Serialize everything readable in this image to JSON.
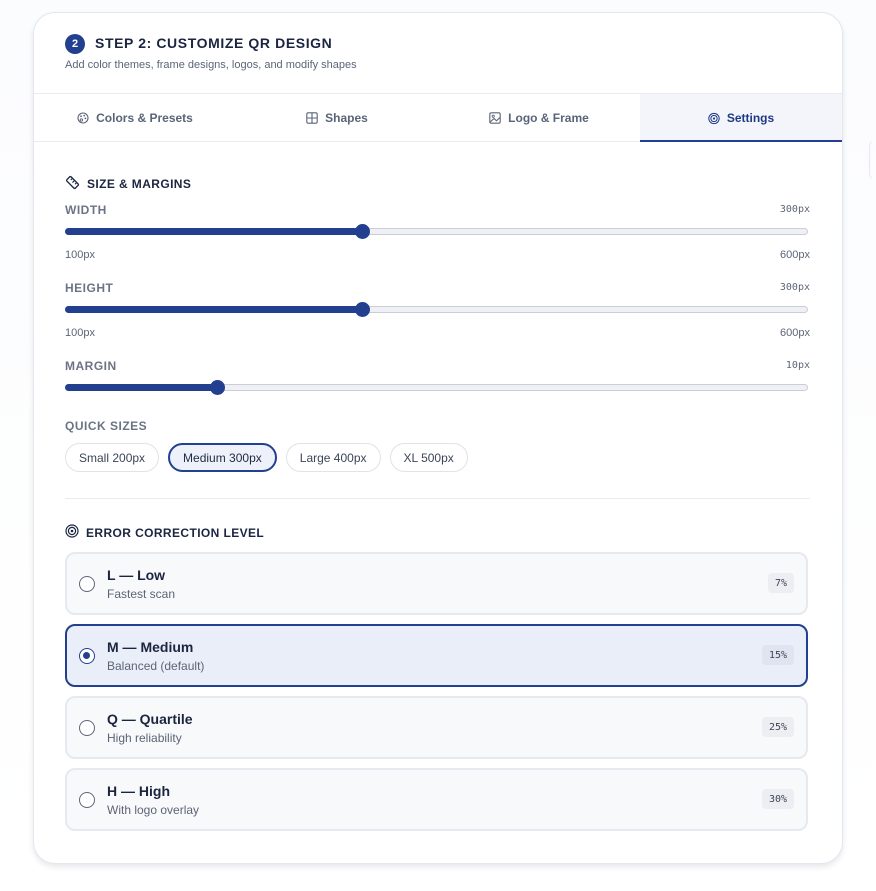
{
  "header": {
    "step_number": "2",
    "title": "STEP 2: CUSTOMIZE QR DESIGN",
    "subtitle": "Add color themes, frame designs, logos, and modify shapes"
  },
  "tabs": [
    {
      "label": "Colors & Presets",
      "icon": "palette-icon",
      "active": false
    },
    {
      "label": "Shapes",
      "icon": "grid-icon",
      "active": false
    },
    {
      "label": "Logo & Frame",
      "icon": "image-icon",
      "active": false
    },
    {
      "label": "Settings",
      "icon": "target-icon",
      "active": true
    }
  ],
  "size_margins": {
    "title": "SIZE & MARGINS",
    "icon": "ruler-icon",
    "width": {
      "label": "WIDTH",
      "value": "300px",
      "min": "100px",
      "max": "600px",
      "fraction": 0.4
    },
    "height": {
      "label": "HEIGHT",
      "value": "300px",
      "min": "100px",
      "max": "600px",
      "fraction": 0.4
    },
    "margin": {
      "label": "MARGIN",
      "value": "10px",
      "fraction": 0.205
    }
  },
  "quick_sizes": {
    "label": "QUICK SIZES",
    "options": [
      {
        "label": "Small 200px",
        "selected": false
      },
      {
        "label": "Medium 300px",
        "selected": true
      },
      {
        "label": "Large 400px",
        "selected": false
      },
      {
        "label": "XL 500px",
        "selected": false
      }
    ]
  },
  "error_correction": {
    "title": "ERROR CORRECTION LEVEL",
    "icon": "target-icon",
    "options": [
      {
        "title": "L — Low",
        "subtitle": "Fastest scan",
        "badge": "7%",
        "selected": false
      },
      {
        "title": "M — Medium",
        "subtitle": "Balanced (default)",
        "badge": "15%",
        "selected": true
      },
      {
        "title": "Q — Quartile",
        "subtitle": "High reliability",
        "badge": "25%",
        "selected": false
      },
      {
        "title": "H — High",
        "subtitle": "With logo overlay",
        "badge": "30%",
        "selected": false
      }
    ]
  },
  "colors": {
    "accent": "#22408f",
    "text": "#1b2540",
    "muted": "#5c6476"
  }
}
